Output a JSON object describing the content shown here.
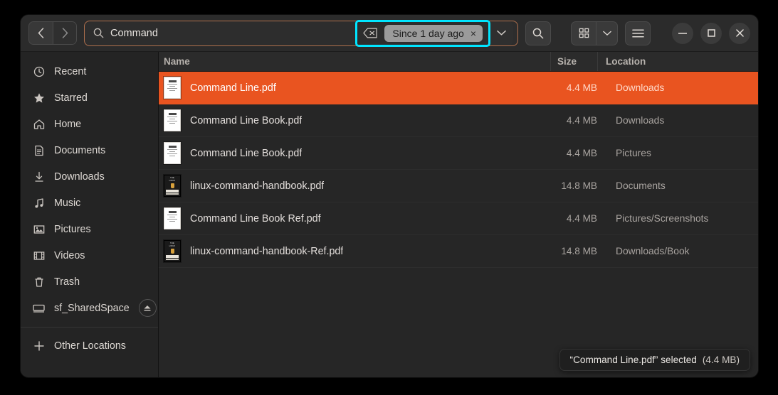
{
  "window": {
    "nav": {
      "back_label": "‹",
      "forward_label": "›"
    },
    "search": {
      "value": "Command",
      "icon": "search-icon"
    },
    "filter": {
      "backspace_icon": "backspace-icon",
      "chip_label": "Since 1 day ago",
      "chip_close": "×",
      "dropdown_icon": "chevron-down-icon",
      "highlight_color": "#00e5ff"
    },
    "search_button_icon": "search-icon",
    "view": {
      "grid_icon": "grid-view-icon",
      "chevron": "chevron-down-icon"
    },
    "menu_icon": "hamburger-menu-icon",
    "controls": {
      "minimize": "—",
      "maximize": "▢",
      "close": "✕"
    }
  },
  "sidebar": {
    "items": [
      {
        "label": "Recent",
        "icon": "clock-icon"
      },
      {
        "label": "Starred",
        "icon": "star-icon"
      },
      {
        "label": "Home",
        "icon": "home-icon"
      },
      {
        "label": "Documents",
        "icon": "document-icon"
      },
      {
        "label": "Downloads",
        "icon": "download-icon"
      },
      {
        "label": "Music",
        "icon": "music-note-icon"
      },
      {
        "label": "Pictures",
        "icon": "image-icon"
      },
      {
        "label": "Videos",
        "icon": "film-icon"
      },
      {
        "label": "Trash",
        "icon": "trash-icon"
      },
      {
        "label": "sf_SharedSpace",
        "icon": "drive-icon",
        "eject": "eject-icon"
      }
    ],
    "other_locations": {
      "label": "Other Locations",
      "icon": "plus-icon"
    }
  },
  "list": {
    "columns": {
      "name": "Name",
      "size": "Size",
      "location": "Location"
    },
    "rows": [
      {
        "name": "Command Line.pdf",
        "size": "4.4 MB",
        "location": "Downloads",
        "thumb": "pdf-page-thumbnail",
        "selected": true
      },
      {
        "name": "Command Line Book.pdf",
        "size": "4.4 MB",
        "location": "Downloads",
        "thumb": "pdf-page-thumbnail",
        "selected": false
      },
      {
        "name": "Command Line Book.pdf",
        "size": "4.4 MB",
        "location": "Pictures",
        "thumb": "pdf-page-thumbnail",
        "selected": false
      },
      {
        "name": "linux-command-handbook.pdf",
        "size": "14.8 MB",
        "location": "Documents",
        "thumb": "book-cover-thumbnail",
        "selected": false
      },
      {
        "name": "Command Line Book Ref.pdf",
        "size": "4.4 MB",
        "location": "Pictures/Screenshots",
        "thumb": "pdf-page-thumbnail",
        "selected": false
      },
      {
        "name": "linux-command-handbook-Ref.pdf",
        "size": "14.8 MB",
        "location": "Downloads/Book",
        "thumb": "book-cover-thumbnail",
        "selected": false
      }
    ]
  },
  "toast": {
    "text": "“Command Line.pdf” selected",
    "size": "(4.4 MB)"
  },
  "colors": {
    "accent": "#e95420",
    "highlight": "#00e5ff",
    "window_bg": "#262626",
    "sidebar_bg": "#242424"
  }
}
